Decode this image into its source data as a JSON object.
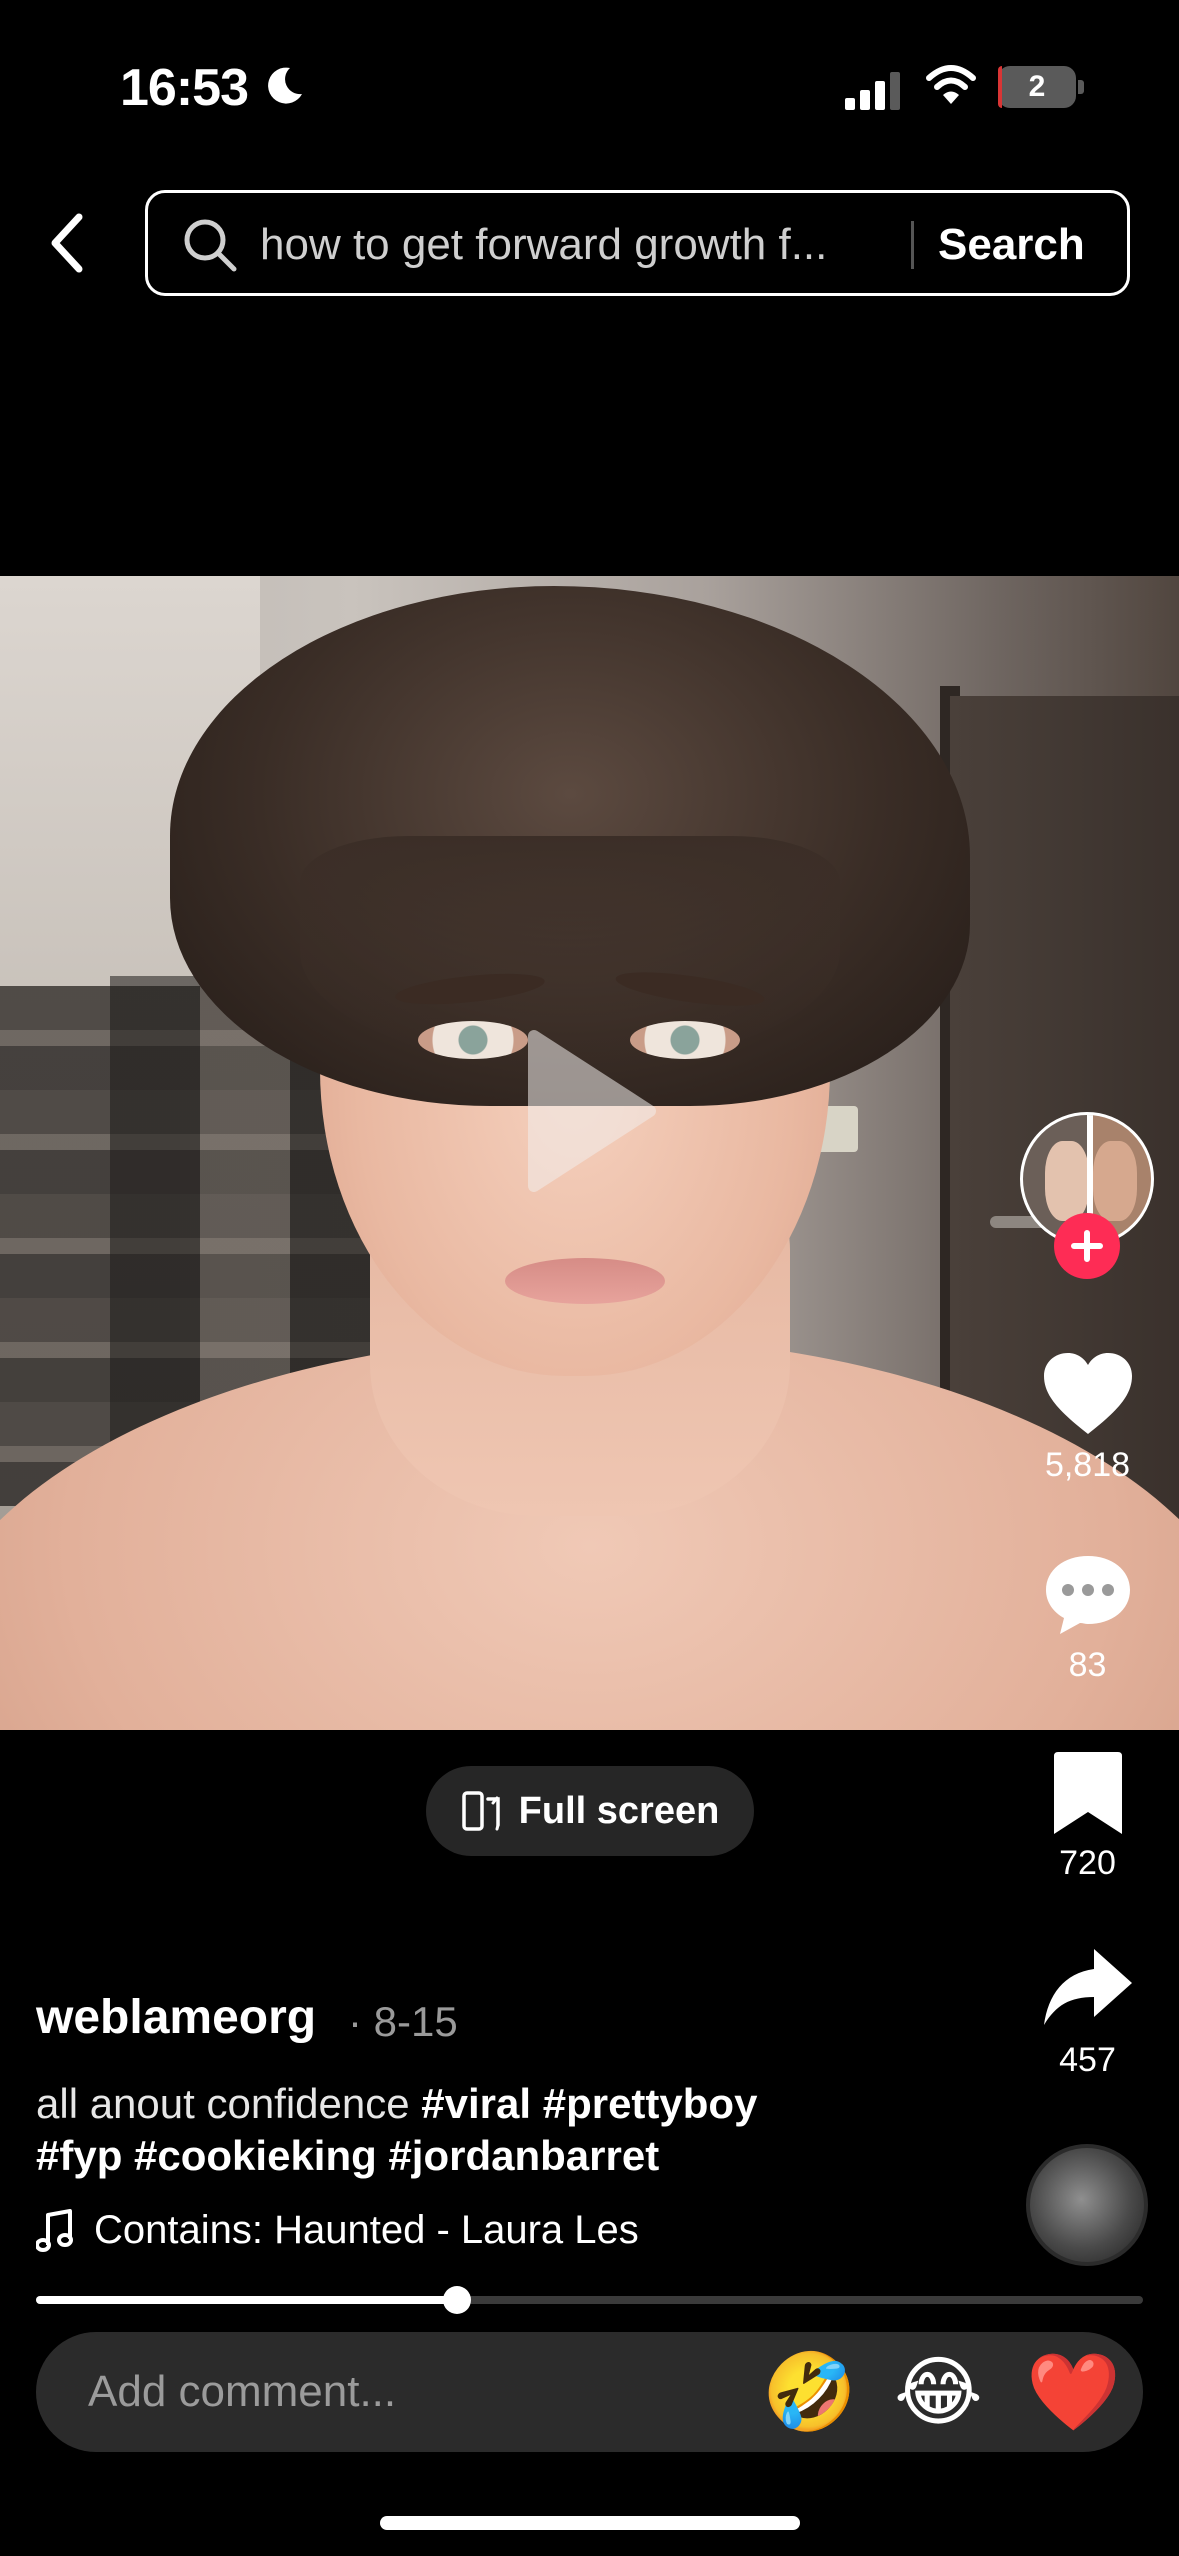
{
  "status_bar": {
    "time": "16:53",
    "battery_level": "2",
    "battery_fraction": 0.05
  },
  "search": {
    "query": "how to get forward growth f...",
    "button_label": "Search"
  },
  "video": {
    "playing": false
  },
  "actions": {
    "likes": "5,818",
    "comments": "83",
    "saves": "720",
    "shares": "457"
  },
  "fullscreen_label": "Full screen",
  "post": {
    "author": "weblameorg",
    "date": "· 8-15",
    "caption_text": "all anout confidence ",
    "caption_tags_line1": "#viral #prettyboy",
    "caption_tags_line2": "#fyp #cookieking #jordanbarret",
    "music": "Contains: Haunted - Laura Les"
  },
  "playback": {
    "progress_fraction": 0.38
  },
  "comment_bar": {
    "placeholder": "Add comment...",
    "emoji_1": "🤣",
    "emoji_2": "😂",
    "emoji_3": "❤️"
  },
  "colors": {
    "accent": "#fe2c55",
    "background": "#000000",
    "battery_low": "#d93535"
  }
}
